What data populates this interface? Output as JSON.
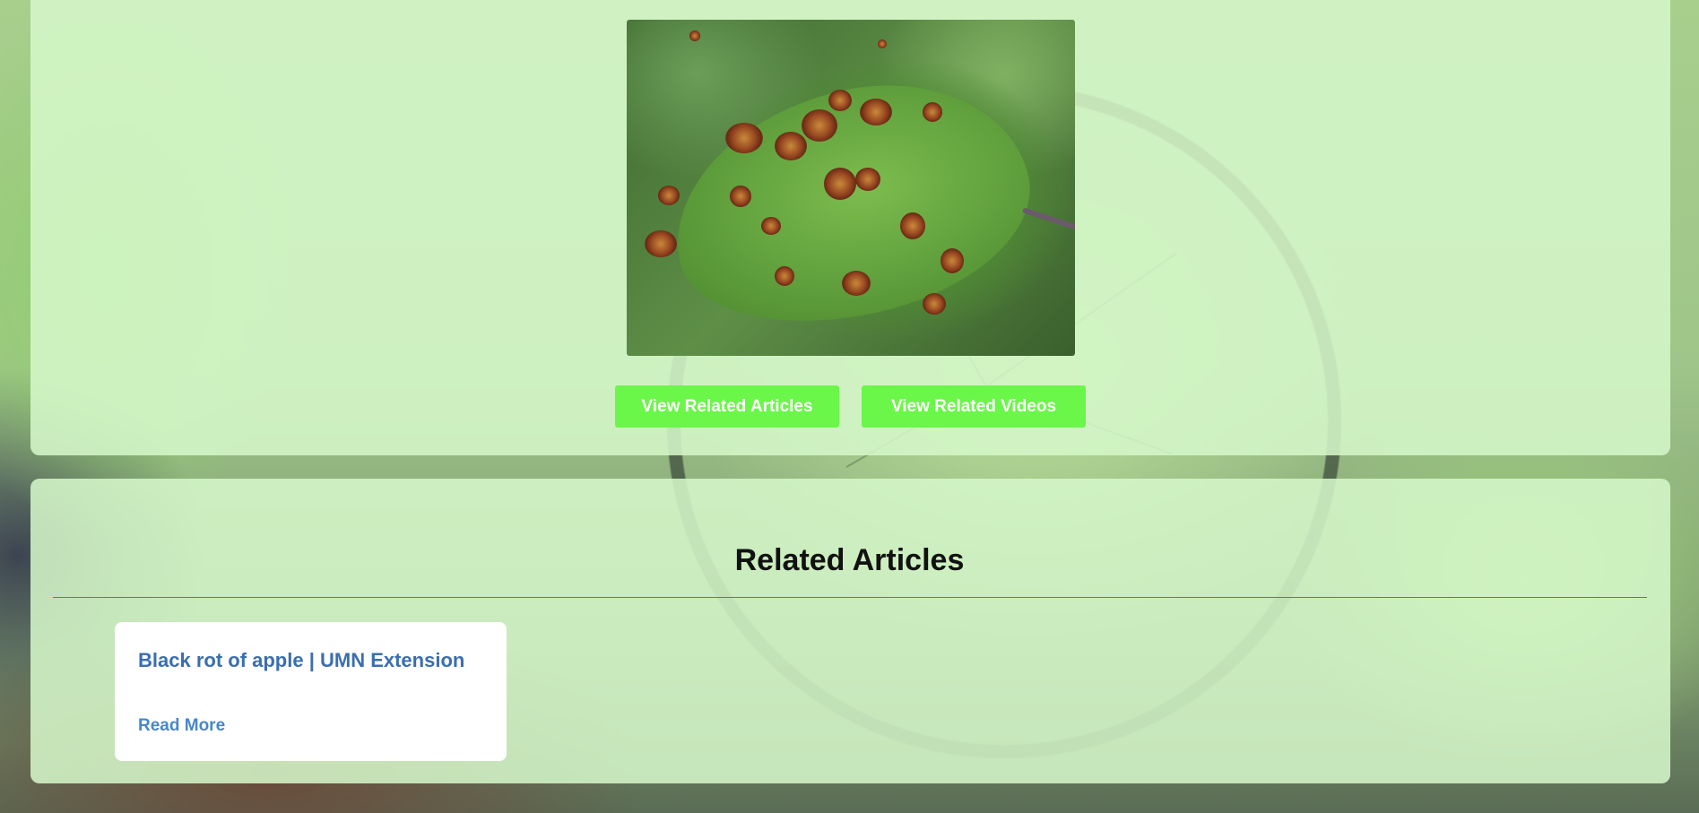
{
  "image": {
    "alt": "Apple leaf with brown rust/rot spots"
  },
  "buttons": {
    "related_articles": "View Related Articles",
    "related_videos": "View Related Videos"
  },
  "related_articles": {
    "heading": "Related Articles",
    "items": [
      {
        "title": "Black rot of apple | UMN Extension",
        "link_label": "Read More"
      }
    ]
  },
  "colors": {
    "accent_button": "#6bf64a",
    "card_title": "#3a6eb0",
    "divider": "#3a7bd5",
    "panel_background": "#d6f8cb"
  }
}
